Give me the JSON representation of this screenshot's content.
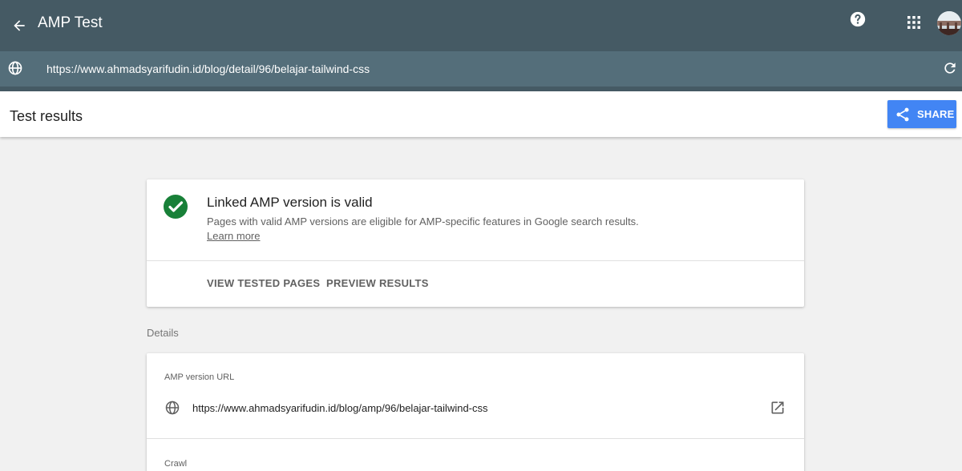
{
  "header": {
    "title": "AMP Test",
    "icons": {
      "back": "arrow-back-icon",
      "help": "help-circle-icon",
      "apps": "apps-grid-icon",
      "avatar": "user-avatar"
    }
  },
  "urlbar": {
    "url": "https://www.ahmadsyarifudin.id/blog/detail/96/belajar-tailwind-css",
    "icons": {
      "left": "globe-icon",
      "right": "reload-icon"
    }
  },
  "results_bar": {
    "title": "Test results",
    "share_label": "SHARE"
  },
  "main_card": {
    "status": "valid",
    "heading": "Linked AMP version is valid",
    "description": "Pages with valid AMP versions are eligible for AMP-specific features in Google search results.",
    "learn_more": "Learn more",
    "actions": {
      "view_tested_pages": "VIEW TESTED PAGES",
      "preview_results": "PREVIEW RESULTS"
    }
  },
  "details": {
    "label": "Details",
    "amp_url_label": "AMP version URL",
    "amp_url": "https://www.ahmadsyarifudin.id/blog/amp/96/belajar-tailwind-css",
    "crawl_label": "Crawl"
  },
  "colors": {
    "topbar": "#455a64",
    "urlbar": "#546e7a",
    "accent": "#4285f4",
    "success": "#188038",
    "background": "#f1f1f1"
  }
}
